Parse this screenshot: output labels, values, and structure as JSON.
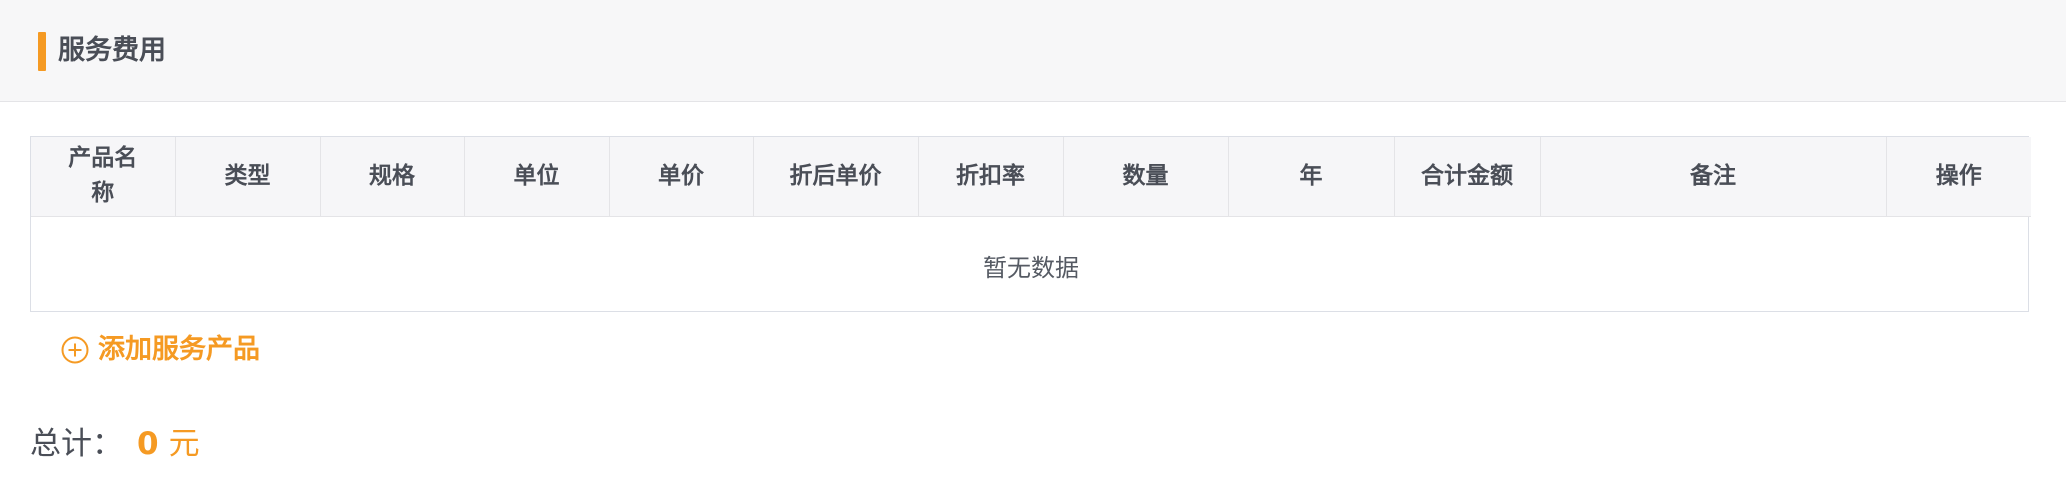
{
  "section": {
    "title": "服务费用"
  },
  "table": {
    "columns": [
      "产品名称",
      "类型",
      "规格",
      "单位",
      "单价",
      "折后单价",
      "折扣率",
      "数量",
      "年",
      "合计金额",
      "备注",
      "操作"
    ],
    "empty_text": "暂无数据"
  },
  "actions": {
    "add_label": "添加服务产品",
    "add_icon": "plus-circle-icon"
  },
  "total": {
    "label": "总计：",
    "value": "0",
    "unit": "元"
  },
  "colors": {
    "accent": "#f59a23",
    "header_bg": "#f7f7f8",
    "text_dark": "#4a4e57",
    "border": "#dcdfe6"
  }
}
